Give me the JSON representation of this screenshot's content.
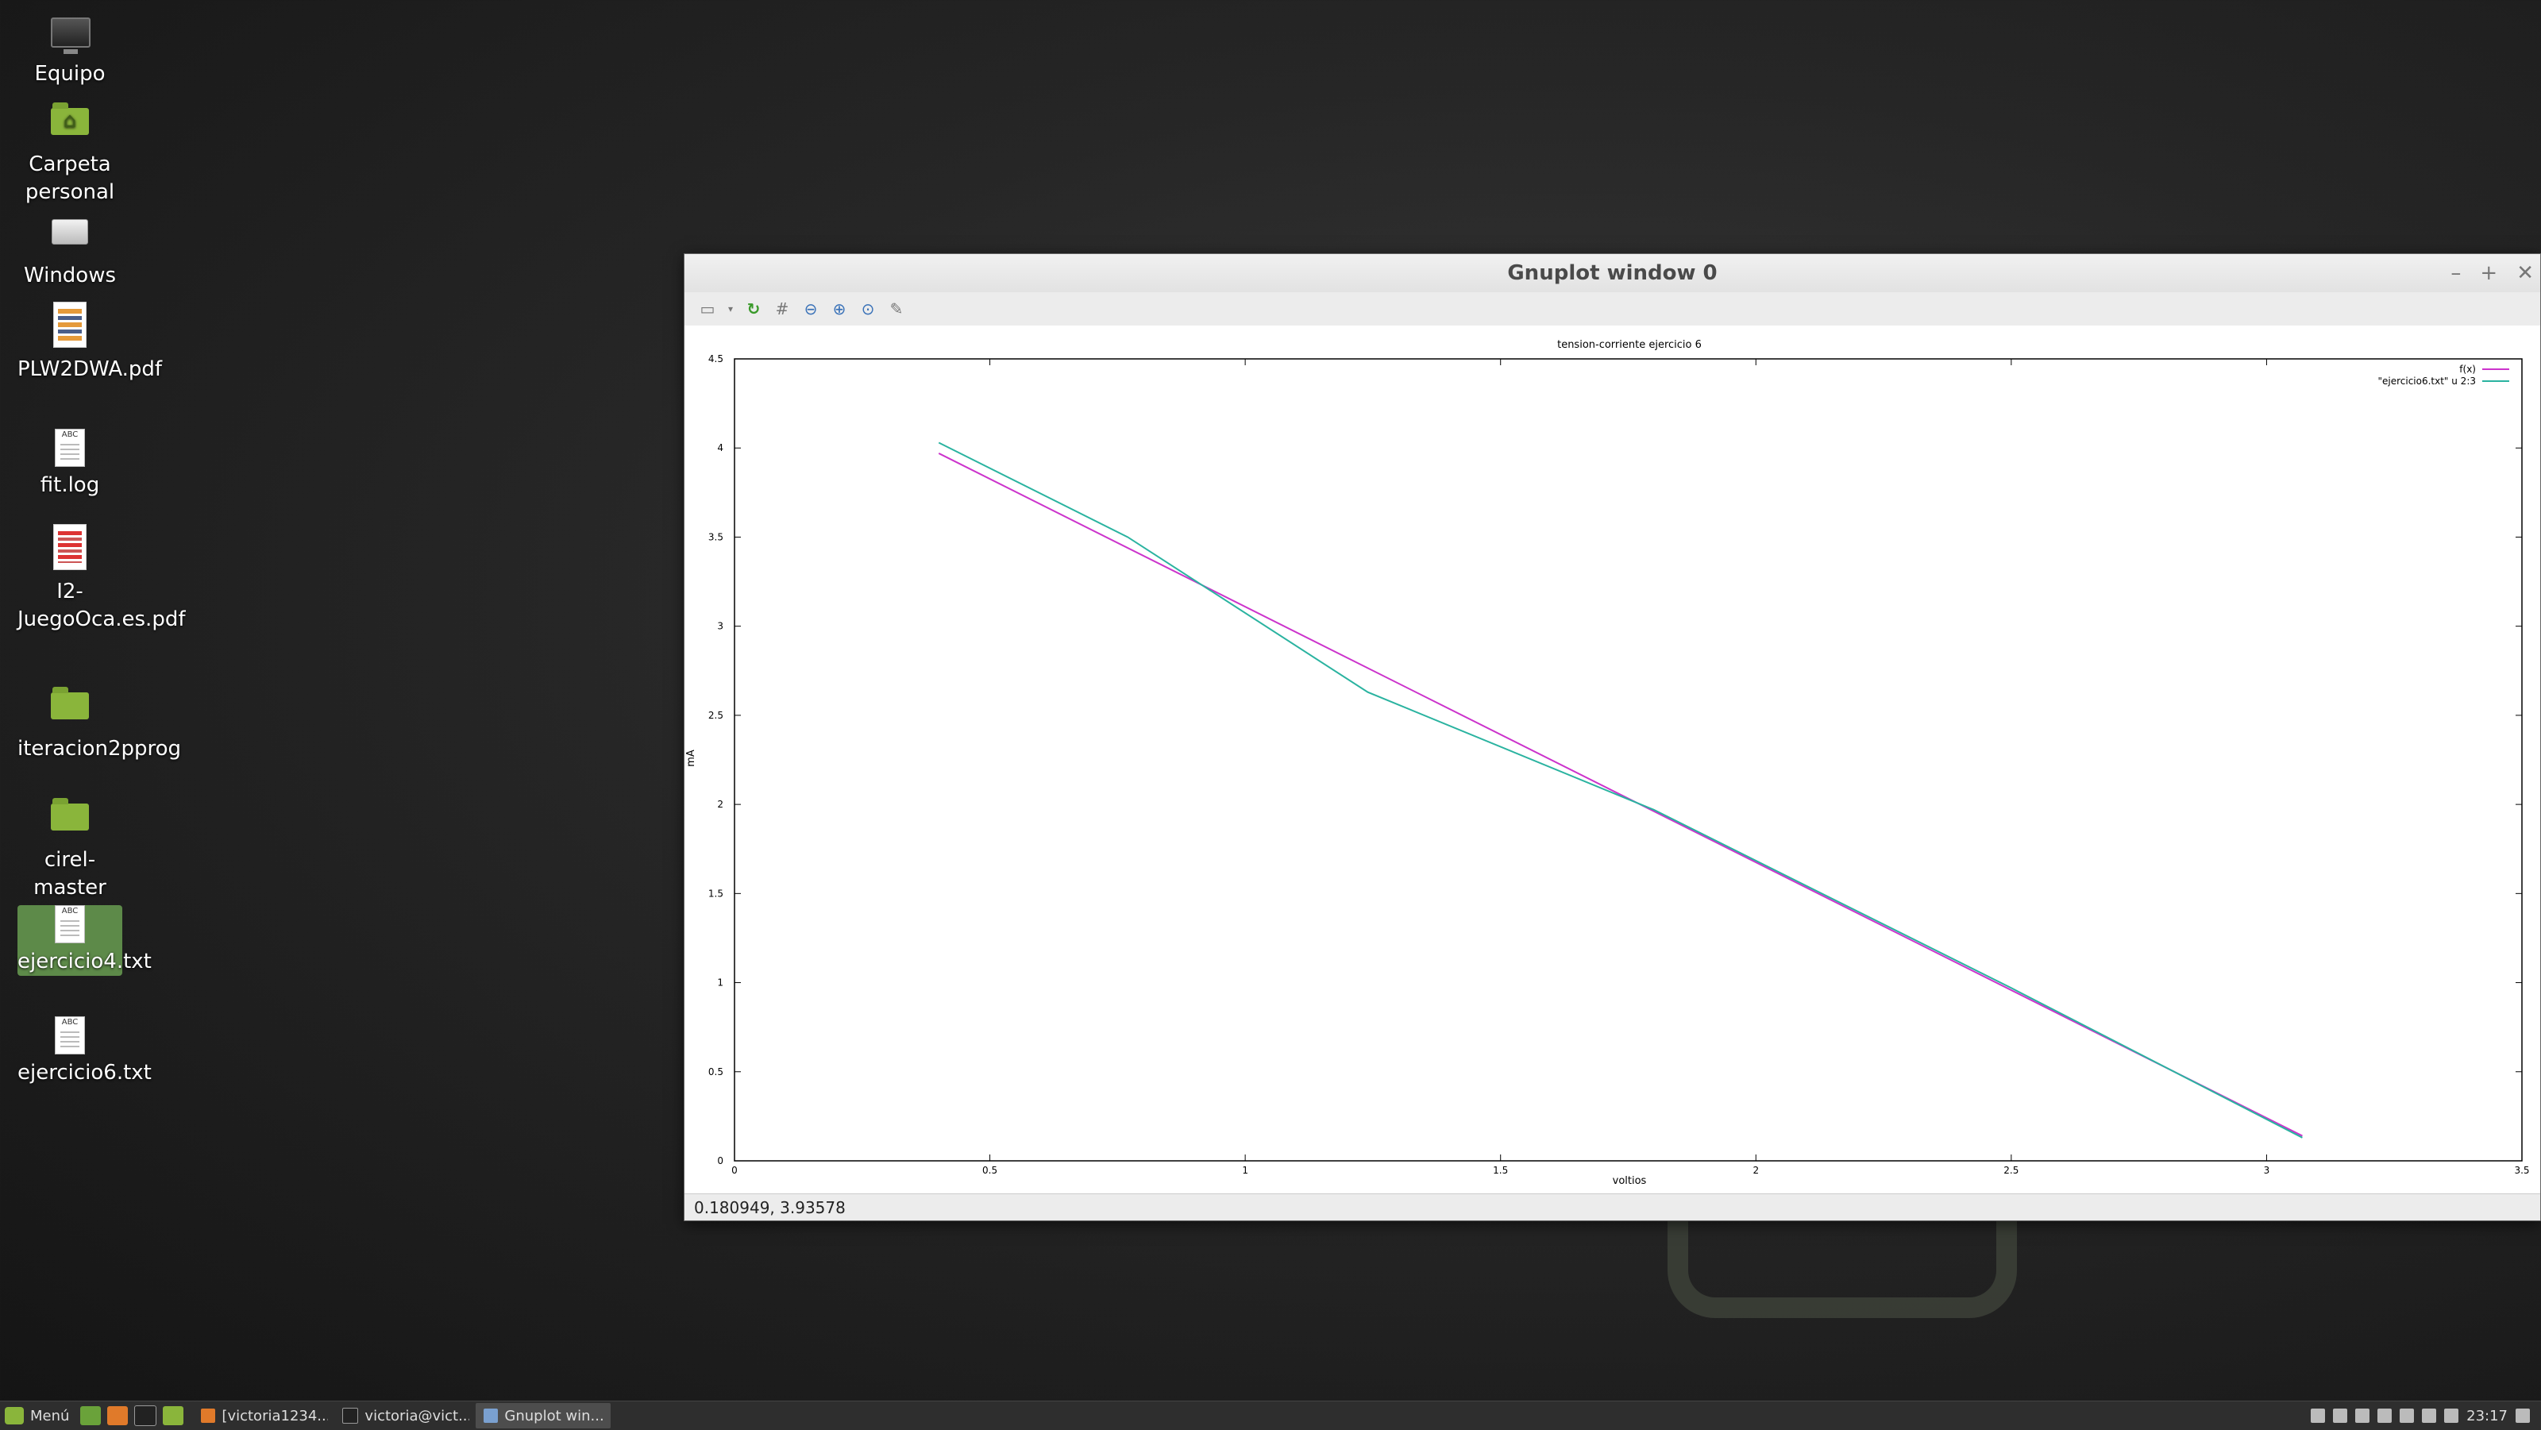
{
  "desktop": {
    "icons": [
      {
        "label": "Equipo"
      },
      {
        "label": "Carpeta personal"
      },
      {
        "label": "Windows"
      },
      {
        "label": "PLW2DWA.pdf"
      },
      {
        "label": "fit.log"
      },
      {
        "label": "I2-JuegoOca.es.pdf"
      },
      {
        "label": "iteracion2pprog"
      },
      {
        "label": "cirel-master"
      },
      {
        "label": "ejercicio4.txt"
      },
      {
        "label": "ejercicio6.txt"
      }
    ]
  },
  "window": {
    "title": "Gnuplot window 0",
    "controls": {
      "minimize": "–",
      "maximize": "+",
      "close": "✕"
    },
    "toolbar": [
      "export-icon",
      "replot-icon",
      "grid-icon",
      "zoom-prev-icon",
      "zoom-next-icon",
      "autoscale-icon",
      "config-icon"
    ],
    "status": "0.180949,  3.93578"
  },
  "chart_data": {
    "type": "line",
    "title": "tension-corriente ejercicio 6",
    "xlabel": "voltios",
    "ylabel": "mA",
    "xlim": [
      0,
      3.5
    ],
    "ylim": [
      0,
      4.5
    ],
    "xticks": [
      "0",
      "0.5",
      "1",
      "1.5",
      "2",
      "2.5",
      "3",
      "3.5"
    ],
    "yticks": [
      "0",
      "0.5",
      "1",
      "1.5",
      "2",
      "2.5",
      "3",
      "3.5",
      "4",
      "4.5"
    ],
    "legend_position": "top-right",
    "series": [
      {
        "name": "f(x)",
        "color": "#cc33cc",
        "x": [
          0.4,
          3.07
        ],
        "y": [
          3.97,
          0.14
        ]
      },
      {
        "name": "\"ejercicio6.txt\" u 2:3",
        "color": "#2ab3a0",
        "x": [
          0.4,
          0.77,
          1.24,
          1.8,
          2.5,
          3.07
        ],
        "y": [
          4.03,
          3.5,
          2.63,
          1.97,
          0.97,
          0.13
        ]
      }
    ]
  },
  "taskbar": {
    "menu_label": "Menú",
    "tasks": [
      "[victoria1234...",
      "victoria@vict...",
      "Gnuplot win..."
    ],
    "clock": "23:17"
  }
}
